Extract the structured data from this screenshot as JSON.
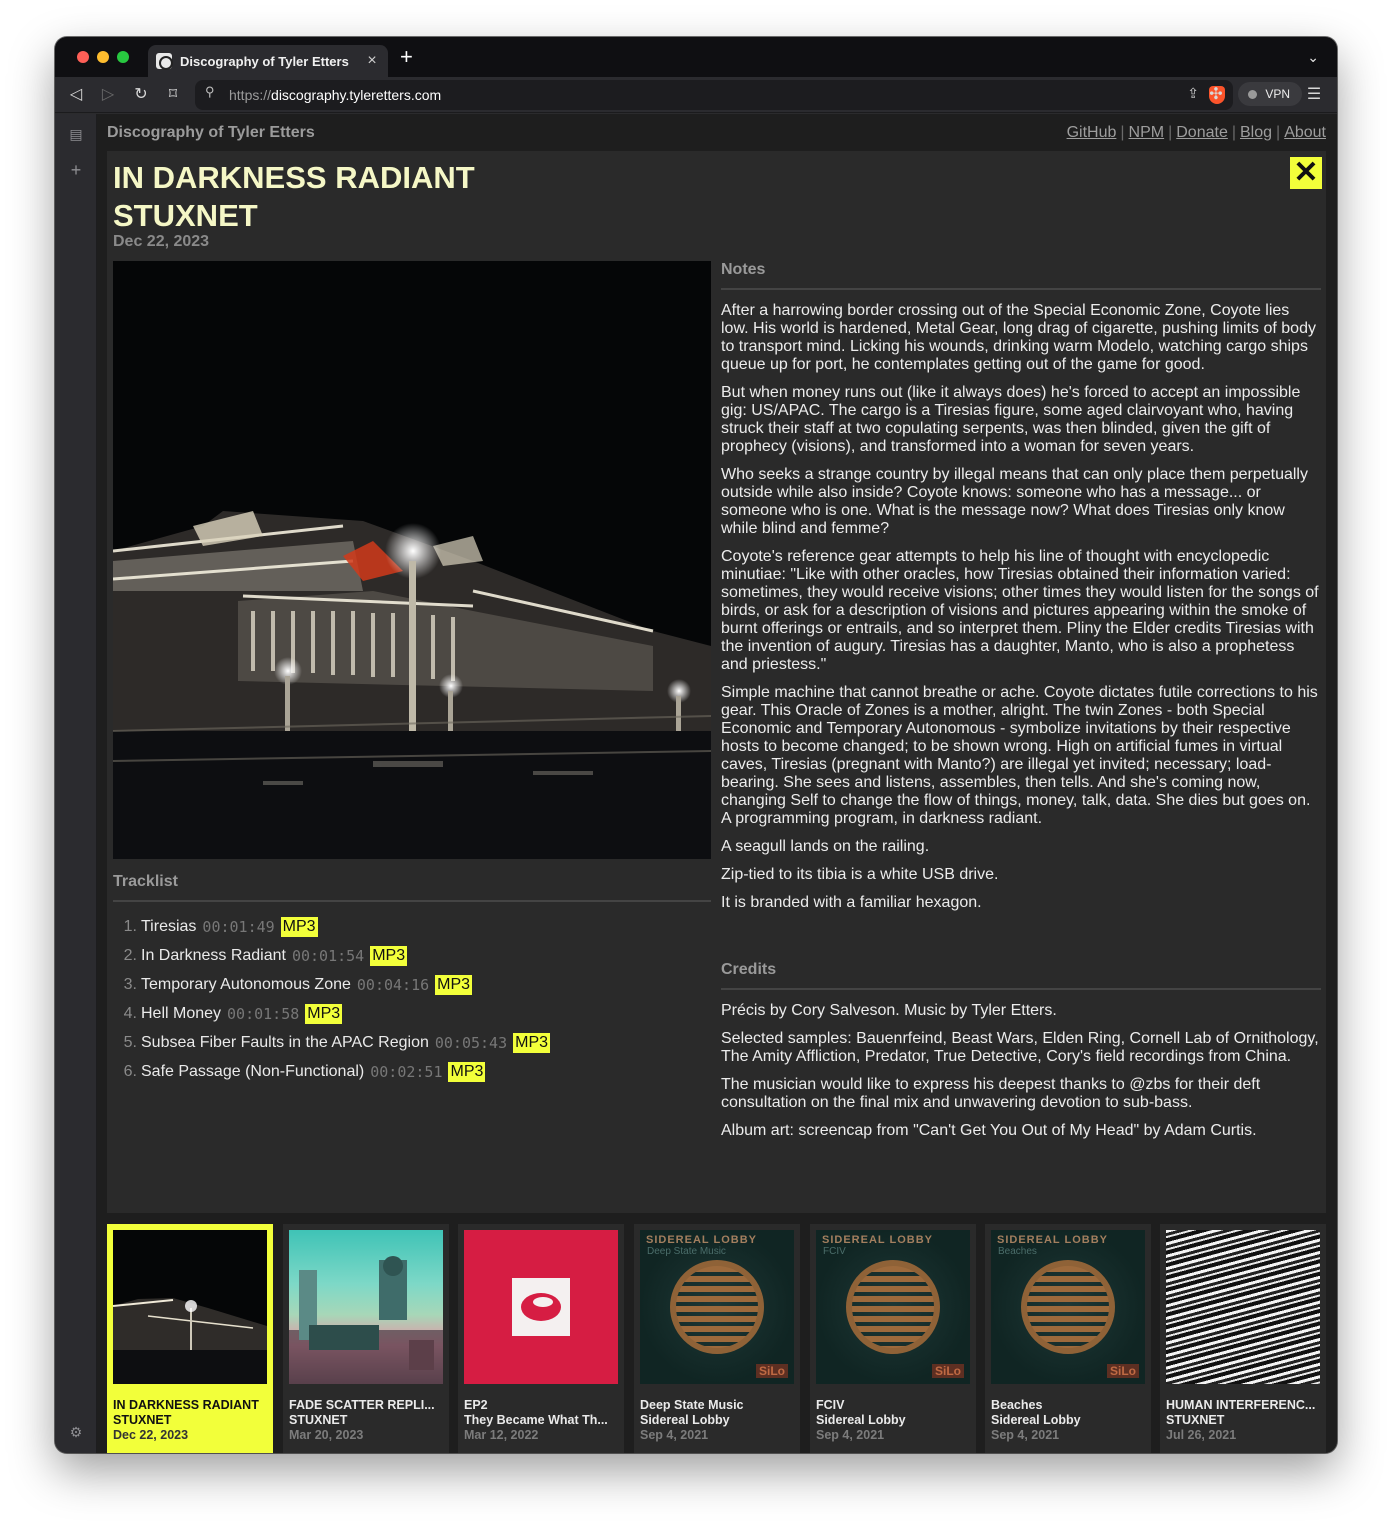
{
  "browser": {
    "tab_title": "Discography of Tyler Etters",
    "url_protocol": "https://",
    "url_host": "discography.tyleretters.com",
    "vpn_label": "VPN",
    "new_tab_glyph": "+",
    "tab_close_glyph": "×"
  },
  "site": {
    "title": "Discography of Tyler Etters",
    "nav": [
      "GitHub",
      "NPM",
      "Donate",
      "Blog",
      "About"
    ],
    "nav_sep": "|"
  },
  "album": {
    "title_line1": "IN DARKNESS RADIANT",
    "title_line2": "STUXNET",
    "date": "Dec 22, 2023",
    "close_glyph": "✕",
    "tracklist_heading": "Tracklist",
    "tracks": [
      {
        "num": "1.",
        "title": "Tiresias",
        "duration": "00:01:49",
        "format": "MP3"
      },
      {
        "num": "2.",
        "title": "In Darkness Radiant",
        "duration": "00:01:54",
        "format": "MP3"
      },
      {
        "num": "3.",
        "title": "Temporary Autonomous Zone",
        "duration": "00:04:16",
        "format": "MP3"
      },
      {
        "num": "4.",
        "title": "Hell Money",
        "duration": "00:01:58",
        "format": "MP3"
      },
      {
        "num": "5.",
        "title": "Subsea Fiber Faults in the APAC Region",
        "duration": "00:05:43",
        "format": "MP3"
      },
      {
        "num": "6.",
        "title": "Safe Passage (Non-Functional)",
        "duration": "00:02:51",
        "format": "MP3"
      }
    ],
    "notes_heading": "Notes",
    "notes": [
      "After a harrowing border crossing out of the Special Economic Zone, Coyote lies low. His world is hardened, Metal Gear, long drag of cigarette, pushing limits of body to transport mind. Licking his wounds, drinking warm Modelo, watching cargo ships queue up for port, he contemplates getting out of the game for good.",
      "But when money runs out (like it always does) he's forced to accept an impossible gig: US/APAC. The cargo is a Tiresias figure, some aged clairvoyant who, having struck their staff at two copulating serpents, was then blinded, given the gift of prophecy (visions), and transformed into a woman for seven years.",
      "Who seeks a strange country by illegal means that can only place them perpetually outside while also inside? Coyote knows: someone who has a message... or someone who is one. What is the message now? What does Tiresias only know while blind and femme?",
      "Coyote's reference gear attempts to help his line of thought with encyclopedic minutiae: \"Like with other oracles, how Tiresias obtained their information varied: sometimes, they would receive visions; other times they would listen for the songs of birds, or ask for a description of visions and pictures appearing within the smoke of burnt offerings or entrails, and so interpret them. Pliny the Elder credits Tiresias with the invention of augury. Tiresias has a daughter, Manto, who is also a prophetess and priestess.\"",
      "Simple machine that cannot breathe or ache. Coyote dictates futile corrections to his gear. This Oracle of Zones is a mother, alright. The twin Zones - both Special Economic and Temporary Autonomous - symbolize invitations by their respective hosts to become changed; to be shown wrong. High on artificial fumes in virtual caves, Tiresias (pregnant with Manto?) are illegal yet invited; necessary; load-bearing. She sees and listens, assembles, then tells. And she's coming now, changing Self to change the flow of things, money, talk, data. She dies but goes on. A programming program, in darkness radiant.",
      "A seagull lands on the railing.",
      "Zip-tied to its tibia is a white USB drive.",
      "It is branded with a familiar hexagon."
    ],
    "credits_heading": "Credits",
    "credits": [
      "Précis by Cory Salveson. Music by Tyler Etters.",
      "Selected samples: Bauenrfeind, Beast Wars, Elden Ring, Cornell Lab of Ornithology, The Amity Affliction, Predator, True Detective, Cory's field recordings from China.",
      "The musician would like to express his deepest thanks to @zbs for their deft consultation on the final mix and unwavering devotion to sub-bass.",
      "Album art: screencap from \"Can't Get You Out of My Head\" by Adam Curtis."
    ]
  },
  "albums": [
    {
      "title": "IN DARKNESS RADIANT",
      "artist": "STUXNET",
      "date": "Dec 22, 2023",
      "active": true
    },
    {
      "title": "FADE SCATTER REPLI...",
      "artist": "STUXNET",
      "date": "Mar 20, 2023"
    },
    {
      "title": "EP2",
      "artist": "They Became What Th...",
      "date": "Mar 12, 2022"
    },
    {
      "title": "Deep State Music",
      "artist": "Sidereal Lobby",
      "date": "Sep 4, 2021",
      "art_header": "SIDEREAL LOBBY",
      "art_sub": "Deep State Music",
      "art_logo": "SiLo"
    },
    {
      "title": "FCIV",
      "artist": "Sidereal Lobby",
      "date": "Sep 4, 2021",
      "art_header": "SIDEREAL LOBBY",
      "art_sub": "FCIV",
      "art_logo": "SiLo"
    },
    {
      "title": "Beaches",
      "artist": "Sidereal Lobby",
      "date": "Sep 4, 2021",
      "art_header": "SIDEREAL LOBBY",
      "art_sub": "Beaches",
      "art_logo": "SiLo"
    },
    {
      "title": "HUMAN INTERFERENC...",
      "artist": "STUXNET",
      "date": "Jul 26, 2021"
    }
  ],
  "colors": {
    "accent": "#f2ff3a",
    "title_text": "#f5f7c6",
    "page_bg": "#1e1e1e",
    "panel_bg": "#2a2a2a"
  }
}
